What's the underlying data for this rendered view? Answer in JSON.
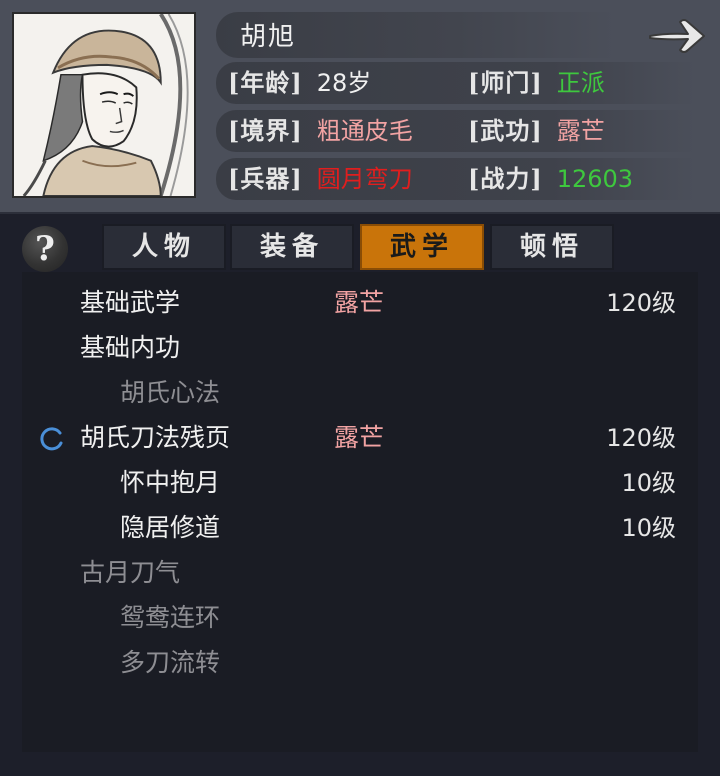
{
  "character": {
    "name": "胡旭",
    "age_label": "[年龄]",
    "age_value": "28岁",
    "sect_label": "[师门]",
    "sect_value": "正派",
    "realm_label": "[境界]",
    "realm_value": "粗通皮毛",
    "martial_label": "[武功]",
    "martial_value": "露芒",
    "weapon_label": "[兵器]",
    "weapon_value": "圆月弯刀",
    "power_label": "[战力]",
    "power_value": "12603"
  },
  "colors": {
    "sect": "#3ec83e",
    "realm": "#f2a3a3",
    "martial": "#f2a3a3",
    "weapon": "#e01e1e",
    "power": "#3ec83e",
    "active_tab": "#c9740a"
  },
  "header": {
    "next_icon": "arrow-right-icon"
  },
  "help": {
    "label": "?"
  },
  "tabs": [
    {
      "label": "人物",
      "active": false
    },
    {
      "label": "装备",
      "active": false
    },
    {
      "label": "武学",
      "active": true
    },
    {
      "label": "顿悟",
      "active": false
    }
  ],
  "skills": [
    {
      "name": "基础武学",
      "style": "露芒",
      "level": "120级",
      "color": "white",
      "indent": 0
    },
    {
      "name": "基础内功",
      "style": "",
      "level": "",
      "color": "white",
      "indent": 0
    },
    {
      "name": "胡氏心法",
      "style": "",
      "level": "",
      "color": "grey",
      "indent": 1
    },
    {
      "name": "胡氏刀法残页",
      "style": "露芒",
      "level": "120级",
      "color": "white",
      "indent": 0,
      "loading_icon": "loading-spinner-icon"
    },
    {
      "name": "怀中抱月",
      "style": "",
      "level": "10级",
      "color": "white",
      "indent": 1
    },
    {
      "name": "隐居修道",
      "style": "",
      "level": "10级",
      "color": "white",
      "indent": 1
    },
    {
      "name": "古月刀气",
      "style": "",
      "level": "",
      "color": "grey",
      "indent": 0
    },
    {
      "name": "鸳鸯连环",
      "style": "",
      "level": "",
      "color": "grey",
      "indent": 1
    },
    {
      "name": "多刀流转",
      "style": "",
      "level": "",
      "color": "grey",
      "indent": 1
    }
  ]
}
